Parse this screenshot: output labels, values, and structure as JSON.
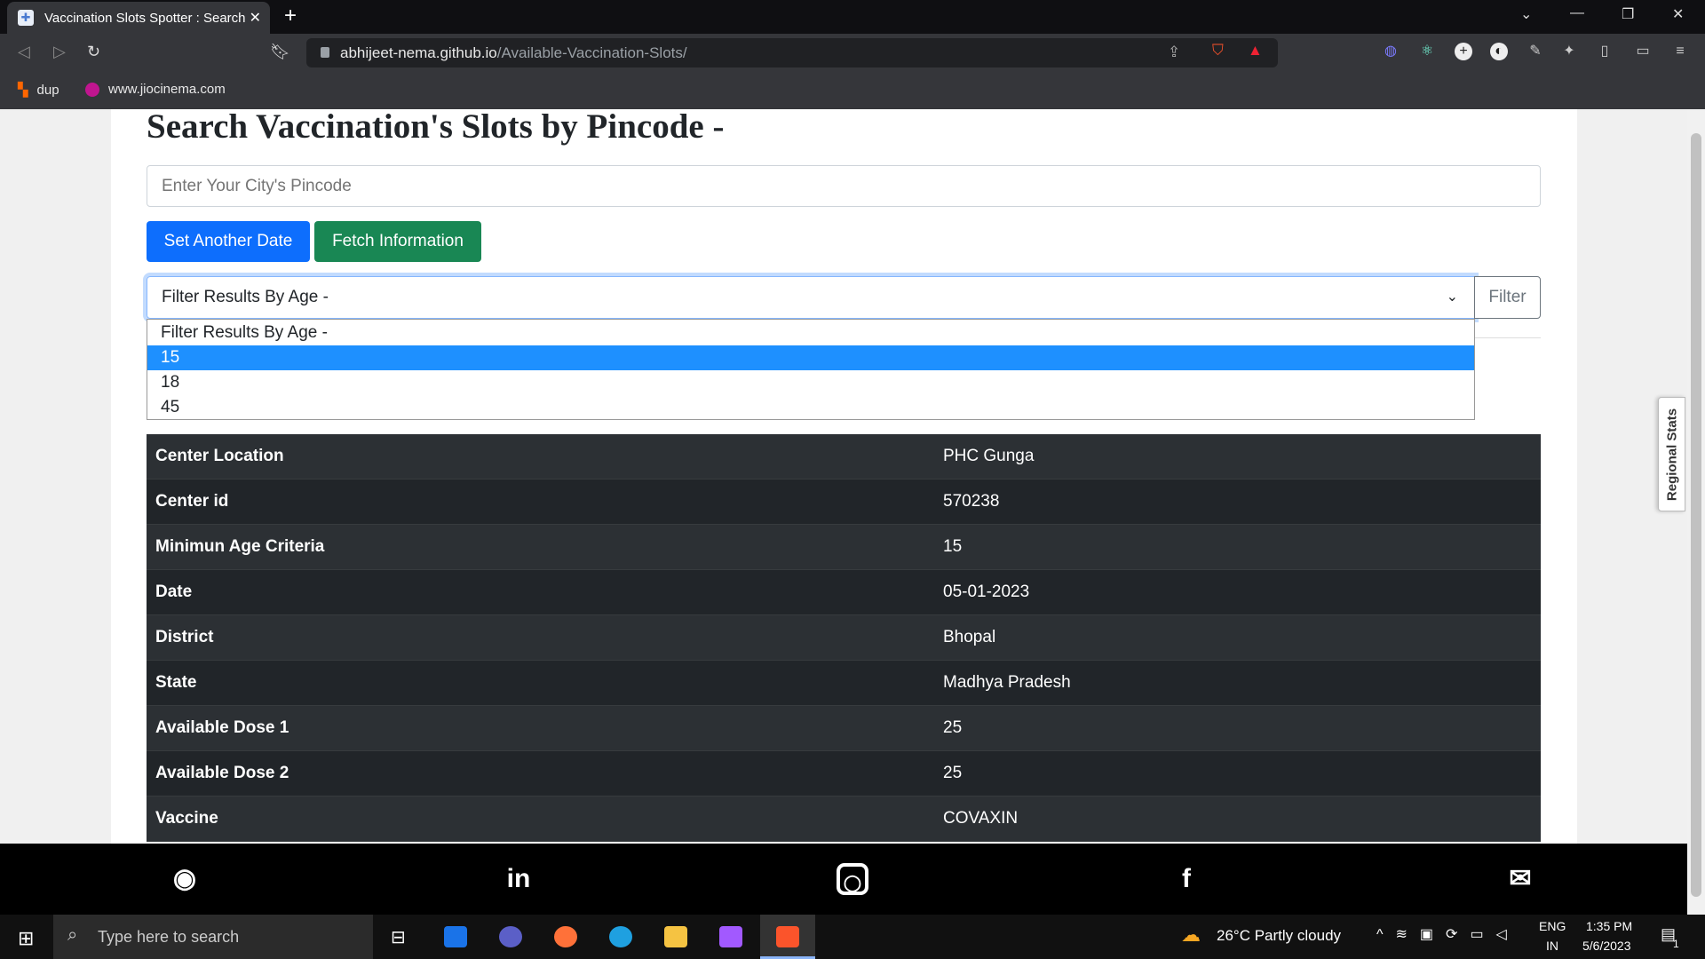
{
  "browser": {
    "tab_title": "Vaccination Slots Spotter : Search",
    "url_host": "abhijeet-nema.github.io",
    "url_path": "/Available-Vaccination-Slots/",
    "bookmarks": [
      {
        "label": "dup"
      },
      {
        "label": "www.jiocinema.com"
      }
    ]
  },
  "page": {
    "title": "Search Vaccination's Slots by Pincode -",
    "pincode_placeholder": "Enter Your City's Pincode",
    "set_date_label": "Set Another Date",
    "fetch_label": "Fetch Information",
    "age_select_value": "Filter Results By Age -",
    "age_options": [
      "Filter Results By Age -",
      "15",
      "18",
      "45"
    ],
    "highlighted_option": "15",
    "filter_label": "Filter",
    "regional_stats_label": "Regional Stats",
    "colors": {
      "primary": "#0d6efd",
      "success": "#198754",
      "table": "#212529"
    }
  },
  "results": [
    {
      "key": "Center Location",
      "value": "PHC Gunga"
    },
    {
      "key": "Center id",
      "value": "570238"
    },
    {
      "key": "Minimun Age Criteria",
      "value": "15"
    },
    {
      "key": "Date",
      "value": "05-01-2023"
    },
    {
      "key": "District",
      "value": "Bhopal"
    },
    {
      "key": "State",
      "value": "Madhya Pradesh"
    },
    {
      "key": "Available Dose 1",
      "value": "25"
    },
    {
      "key": "Available Dose 2",
      "value": "25"
    },
    {
      "key": "Vaccine",
      "value": "COVAXIN"
    }
  ],
  "footer": {
    "icons": [
      "github-icon",
      "linkedin-icon",
      "instagram-icon",
      "facebook-icon",
      "mail-icon"
    ]
  },
  "taskbar": {
    "search_placeholder": "Type here to search",
    "weather": "26°C  Partly cloudy",
    "lang1": "ENG",
    "lang2": "IN",
    "time": "1:35 PM",
    "date": "5/6/2023",
    "notifications": "1"
  }
}
